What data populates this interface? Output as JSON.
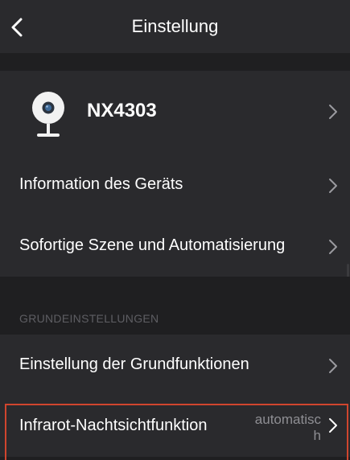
{
  "header": {
    "title": "Einstellung",
    "back_icon": "chevron-left-icon"
  },
  "device": {
    "name": "NX4303",
    "icon": "camera-icon"
  },
  "rows": {
    "device_info": "Information des Geräts",
    "scene_automation": "Sofortige Szene und Automatisierung",
    "basic_functions": "Einstellung der Grundfunktionen",
    "infrared": "Infrarot-Nachtsichtfunktion",
    "infrared_value": "automatisch"
  },
  "sections": {
    "basic_settings": "GRUNDEINSTELLUNGEN"
  },
  "colors": {
    "background": "#1f1f21",
    "card": "#2a2a2d",
    "highlight": "#d0452e",
    "muted_text": "#8e8e93"
  }
}
